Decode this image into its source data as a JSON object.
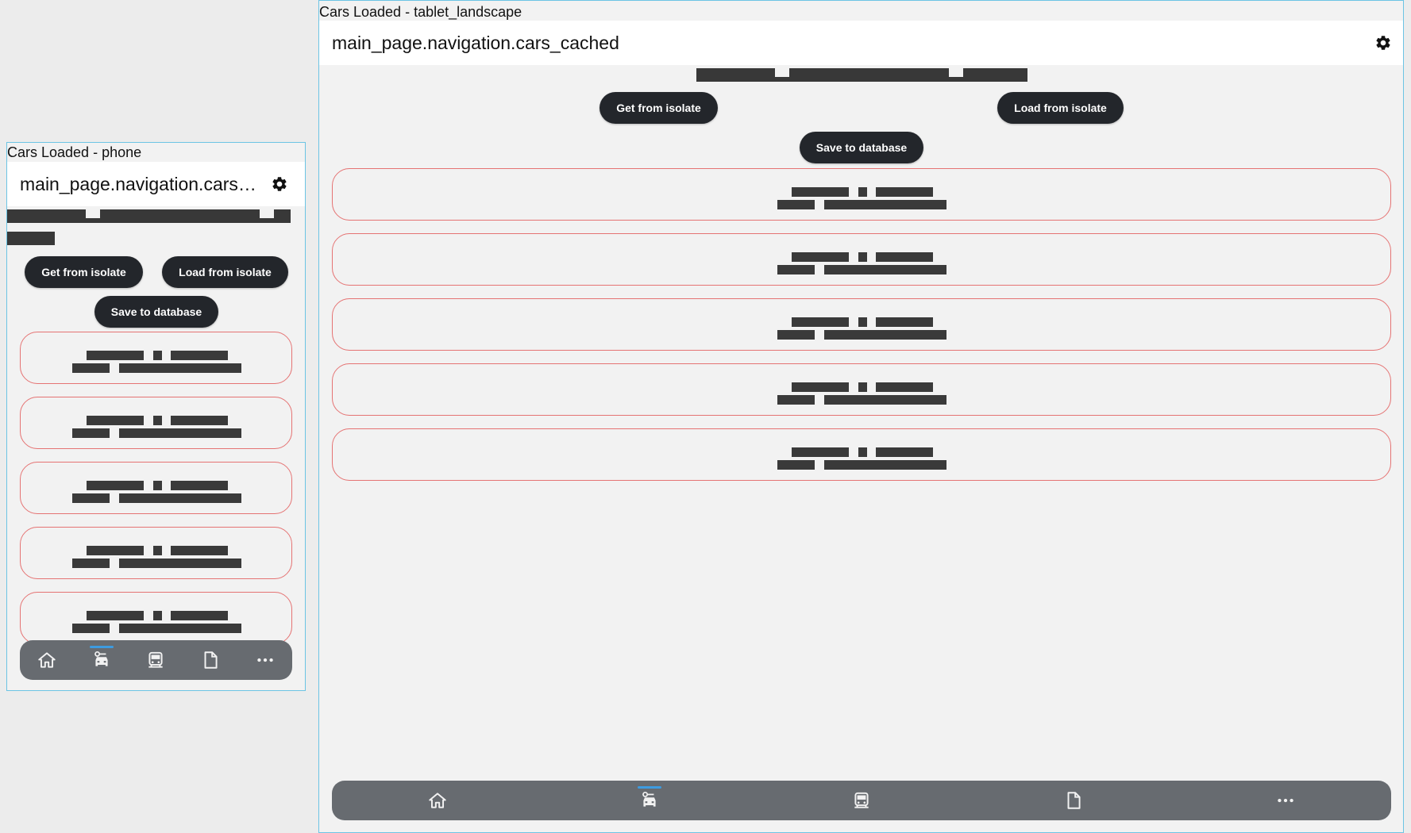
{
  "phone": {
    "label": "Cars Loaded - phone",
    "appbar_title": "main_page.navigation.cars_cached",
    "buttons": {
      "get_from_isolate": "Get from isolate",
      "load_from_isolate": "Load from isolate",
      "save_to_database": "Save to database"
    },
    "car_count": 5,
    "nav_items": [
      {
        "name": "home-icon",
        "active": false
      },
      {
        "name": "cars-icon",
        "active": true
      },
      {
        "name": "bus-icon",
        "active": false
      },
      {
        "name": "document-icon",
        "active": false
      },
      {
        "name": "more-icon",
        "active": false
      }
    ]
  },
  "tablet": {
    "label": "Cars Loaded - tablet_landscape",
    "appbar_title": "main_page.navigation.cars_cached",
    "buttons": {
      "get_from_isolate": "Get from isolate",
      "load_from_isolate": "Load from isolate",
      "save_to_database": "Save to database"
    },
    "car_count": 5,
    "nav_items": [
      {
        "name": "home-icon",
        "active": false
      },
      {
        "name": "cars-icon",
        "active": true
      },
      {
        "name": "bus-icon",
        "active": false
      },
      {
        "name": "document-icon",
        "active": false
      },
      {
        "name": "more-icon",
        "active": false
      }
    ]
  },
  "colors": {
    "card_border": "#e57373",
    "button_bg": "#23262b",
    "navbar_bg": "#676b70",
    "active_indicator": "#3d9be0",
    "frame_border": "#6cc4e4"
  }
}
